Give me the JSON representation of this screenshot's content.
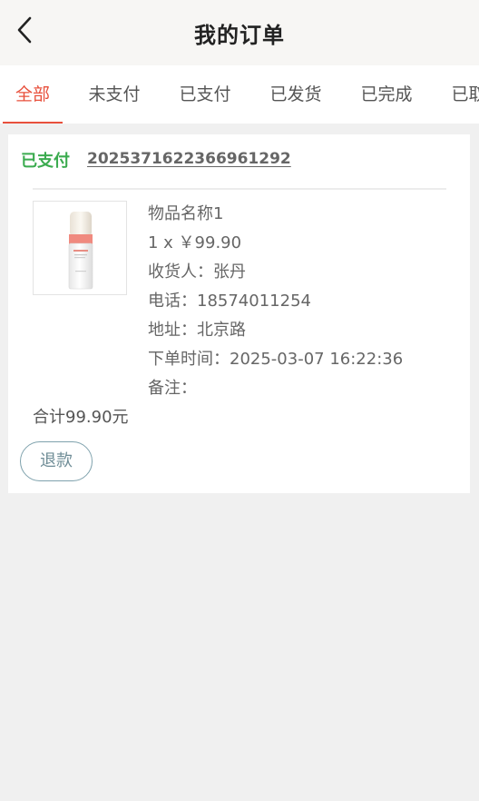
{
  "header": {
    "title": "我的订单",
    "back_icon": "chevron-left-icon"
  },
  "tabs": [
    {
      "label": "全部",
      "active": true
    },
    {
      "label": "未支付",
      "active": false
    },
    {
      "label": "已支付",
      "active": false
    },
    {
      "label": "已发货",
      "active": false
    },
    {
      "label": "已完成",
      "active": false
    },
    {
      "label": "已取消",
      "active": false
    }
  ],
  "order": {
    "status": "已支付",
    "order_no": "2025371622366961292",
    "product_image": "product-bottle-image",
    "product_name": "物品名称1",
    "qty_price": "1 x ￥99.90",
    "receiver": "收货人：张丹",
    "phone": "电话：18574011254",
    "address": "地址：北京路",
    "order_time": "下单时间：2025-03-07 16:22:36",
    "remark": "备注：",
    "total": "合计99.90元",
    "refund_label": "退款"
  },
  "colors": {
    "accent": "#e8503c",
    "paid_status": "#3bab4f",
    "refund_border": "#7fa2ad",
    "background": "#f0f0f0"
  }
}
